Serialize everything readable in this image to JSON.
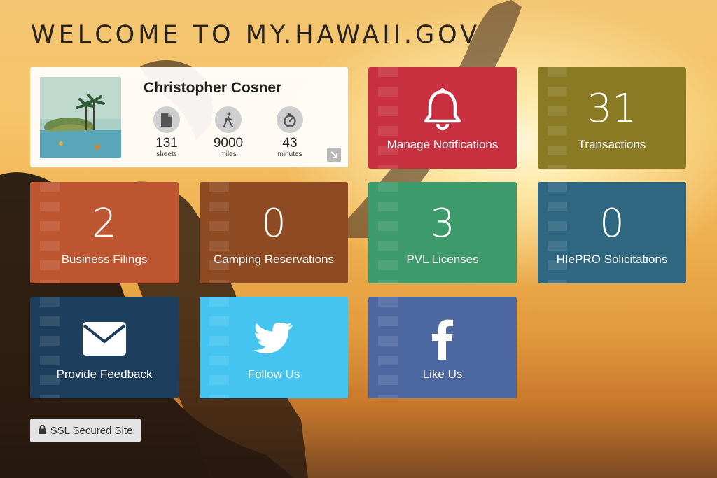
{
  "page": {
    "title": "WELCOME TO MY.HAWAII.GOV"
  },
  "profile": {
    "name": "Christopher Cosner",
    "stats": [
      {
        "icon": "document-icon",
        "value": "131",
        "label": "sheets"
      },
      {
        "icon": "walking-person-icon",
        "value": "9000",
        "label": "miles"
      },
      {
        "icon": "stopwatch-icon",
        "value": "43",
        "label": "minutes"
      }
    ]
  },
  "tiles": {
    "notifications": {
      "label": "Manage Notifications",
      "icon": "bell-icon",
      "color": "#c8303f"
    },
    "transactions": {
      "count": "31",
      "label": "Transactions",
      "color": "#8a7a24"
    },
    "business": {
      "count": "2",
      "label": "Business Filings",
      "color": "#bd5530"
    },
    "camping": {
      "count": "0",
      "label": "Camping Reservations",
      "color": "#8e4a22"
    },
    "pvl": {
      "count": "3",
      "label": "PVL Licenses",
      "color": "#3d9a6a"
    },
    "hiepro": {
      "count": "0",
      "label": "HIePRO Solicitations",
      "color": "#2f6680"
    },
    "feedback": {
      "label": "Provide Feedback",
      "icon": "envelope-icon",
      "color": "#1d3e5c"
    },
    "follow": {
      "label": "Follow Us",
      "icon": "twitter-icon",
      "color": "#44c4ef"
    },
    "like": {
      "label": "Like Us",
      "icon": "facebook-icon",
      "color": "#4d68a0"
    }
  },
  "footer": {
    "ssl_label": "SSL Secured Site",
    "ssl_icon": "lock-icon"
  }
}
